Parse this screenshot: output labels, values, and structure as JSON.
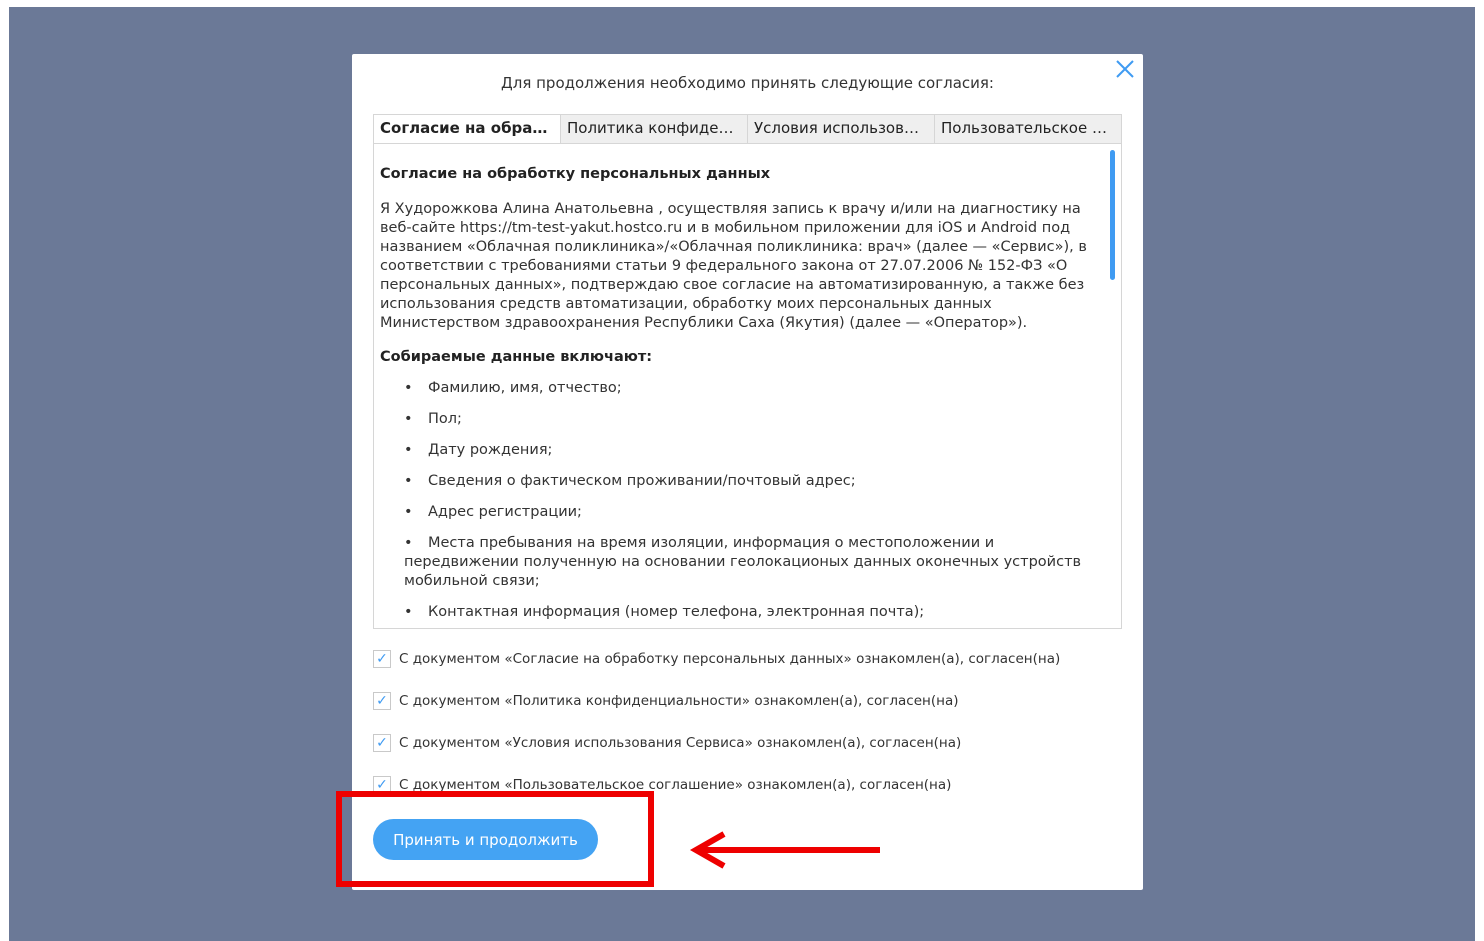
{
  "modal": {
    "header": "Для продолжения необходимо принять следующие согласия:",
    "tabs": [
      {
        "label": "Согласие на обработку персональных данных",
        "active": true
      },
      {
        "label": "Политика конфиденциальности",
        "active": false
      },
      {
        "label": "Условия использования Сервиса",
        "active": false
      },
      {
        "label": "Пользовательское соглашение",
        "active": false
      }
    ],
    "document": {
      "title": "Согласие на обработку персональных данных",
      "paragraph": "Я Худорожкова Алина Анатольевна , осуществляя запись к врачу и/или на диагностику на веб-сайте https://tm-test-yakut.hostco.ru и в мобильном приложении для iOS и Android под названием «Облачная поликлиника»/«Облачная поликлиника: врач» (далее — «Сервис»), в соответствии с требованиями статьи 9 федерального закона от 27.07.2006 № 152-ФЗ «О персональных данных», подтверждаю свое согласие на автоматизированную, а также без использования средств автоматизации, обработку моих персональных данных Министерством здравоохранения Республики Саха (Якутия) (далее — «Оператор»).",
      "collected_title": "Собираемые данные включают:",
      "items": [
        "Фамилию, имя, отчество;",
        "Пол;",
        "Дату рождения;",
        "Сведения о фактическом проживании/почтовый адрес;",
        "Адрес регистрации;",
        "Места пребывания на время изоляции, информация о местоположении и передвижении полученную на основании геолокационых данных оконечных устройств мобильной связи;",
        "Контактная информация (номер телефона, электронная почта);"
      ]
    },
    "agreements": [
      {
        "label": "С документом «Согласие на обработку персональных данных» ознакомлен(а), согласен(на)",
        "checked": true
      },
      {
        "label": "С документом «Политика конфиденциальности» ознакомлен(а), согласен(на)",
        "checked": true
      },
      {
        "label": "С документом «Условия использования Сервиса» ознакомлен(а), согласен(на)",
        "checked": true
      },
      {
        "label": "С документом «Пользовательское соглашение» ознакомлен(а), согласен(на)",
        "checked": true
      }
    ],
    "check_glyph": "✓",
    "accept_button": "Принять и продолжить"
  },
  "colors": {
    "backdrop": "#6b7997",
    "accent": "#44a3f3",
    "annotation": "#ee0000"
  },
  "icons": {
    "close": "close-icon",
    "arrow": "arrow-left-icon"
  }
}
